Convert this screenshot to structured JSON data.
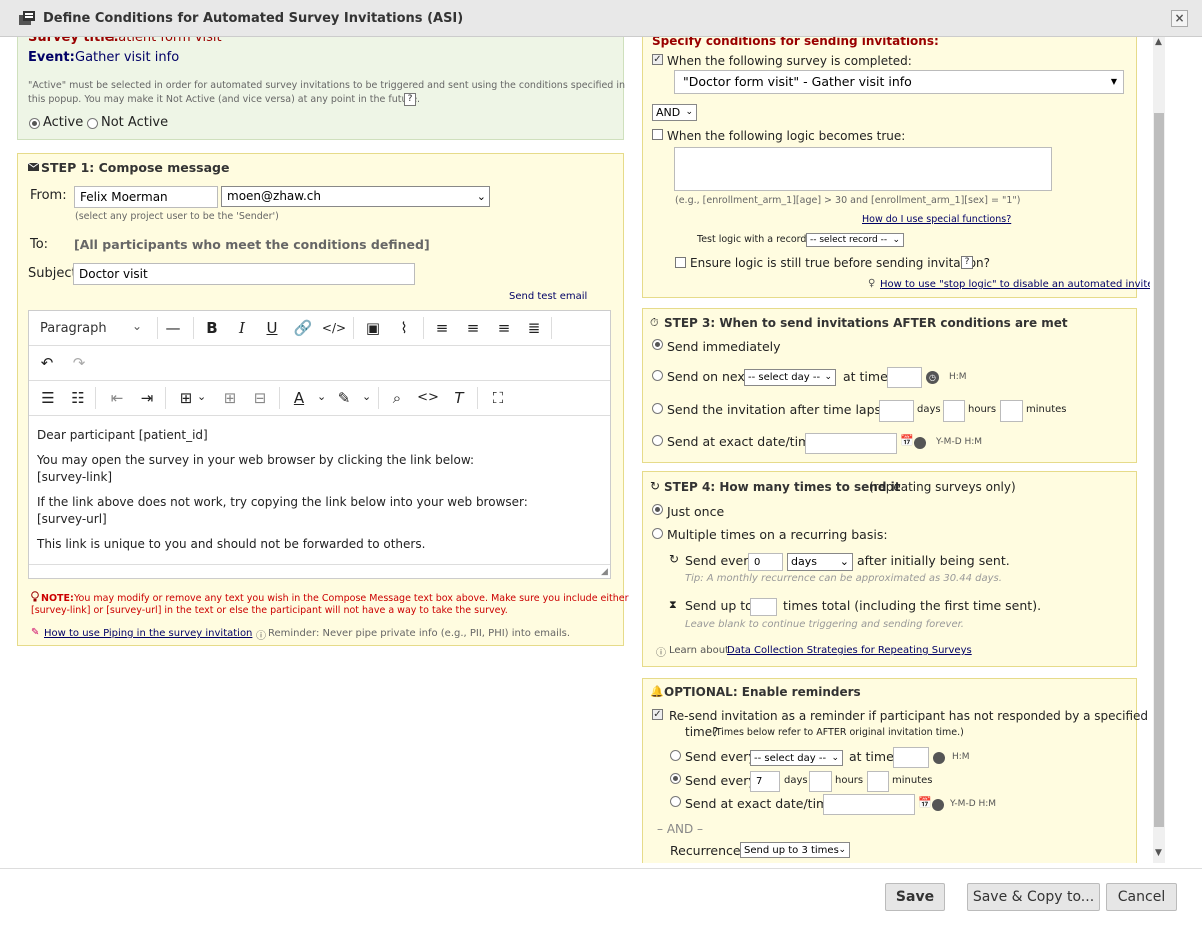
{
  "dialog": {
    "title": "Define Conditions for Automated Survey Invitations (ASI)",
    "close_label": "×"
  },
  "info": {
    "survey_label": "Survey title:",
    "survey_value": "Patient form visit",
    "event_label": "Event:",
    "event_value": "Gather visit info",
    "note_line1": "\"Active\" must be selected in order for automated survey invitations to be triggered and sent using the conditions specified in",
    "note_line2": "this popup. You may make it Not Active (and vice versa) at any point in the future.",
    "help": "?",
    "active": "Active",
    "not_active": "Not Active"
  },
  "step1": {
    "title": "STEP 1: Compose message",
    "from_label": "From:",
    "from_name": "Felix Moerman",
    "from_email": "moen@zhaw.ch",
    "from_hint": "(select any project user to be the 'Sender')",
    "to_label": "To:",
    "to_value": "[All participants who meet the conditions defined]",
    "subject_label": "Subject:",
    "subject_value": "Doctor visit",
    "send_test": "Send test email",
    "paragraph": "Paragraph",
    "body": {
      "l1": "Dear participant [patient_id]",
      "l2": "You may open the survey in your web browser by clicking the link below:",
      "l3": "[survey-link]",
      "l4": "If the link above does not work, try copying the link below into your web browser:",
      "l5": "[survey-url]",
      "l6": "This link is unique to you and should not be forwarded to others."
    },
    "note_label": "NOTE:",
    "note_line1": "You may modify or remove any text you wish in the Compose Message text box above. Make sure you include either",
    "note_line2": "[survey-link] or [survey-url] in the text or else the participant will not have a way to take the survey.",
    "piping_link": "How to use Piping in the survey invitation",
    "reminder": "Reminder: Never pipe private info (e.g., PII, PHI) into emails."
  },
  "step2": {
    "title": "Specify conditions for sending invitations:",
    "survey_completed": "When the following survey is completed:",
    "survey_select": "\"Doctor form visit\" - Gather visit info",
    "and_select": "AND",
    "logic_true": "When the following logic becomes true:",
    "logic_example": "(e.g., [enrollment_arm_1][age] > 30 and [enrollment_arm_1][sex] = \"1\")",
    "special_functions": "How do I use special functions?",
    "test_logic": "Test logic with a record:",
    "select_record": "-- select record --",
    "ensure_logic": "Ensure logic is still true before sending invitation?",
    "help": "?",
    "stop_logic": "How to use \"stop logic\" to disable an automated invite"
  },
  "step3": {
    "title": "STEP 3: When to send invitations AFTER conditions are met",
    "immediately": "Send immediately",
    "on_next": "Send on next",
    "select_day": "-- select day --",
    "at_time": "at time",
    "hm": "H:M",
    "time_lapse": "Send the invitation after time lapse of",
    "days": "days",
    "hours": "hours",
    "minutes": "minutes",
    "exact": "Send at exact date/time:",
    "ymdhm": "Y-M-D H:M"
  },
  "step4": {
    "title": "STEP 4: How many times to send it",
    "title_suffix": "(repeating surveys only)",
    "just_once": "Just once",
    "multiple": "Multiple times on a recurring basis:",
    "send_every": "Send every",
    "every_value": "0",
    "days_select": "days",
    "after": "after initially being sent.",
    "tip1": "Tip: A monthly recurrence can be approximated as 30.44 days.",
    "send_up_to": "Send up to",
    "times_total": "times total (including the first time sent).",
    "tip2": "Leave blank to continue triggering and sending forever.",
    "learn": "Learn about",
    "learn_link": "Data Collection Strategies for Repeating Surveys"
  },
  "reminders": {
    "title": "OPTIONAL: Enable reminders",
    "resend_line1": "Re-send invitation as a reminder if participant has not responded by a specified",
    "resend_line2": "time?",
    "resend_note": "(Times below refer to AFTER original invitation time.)",
    "send_every": "Send every",
    "select_day": "-- select day --",
    "at_time": "at time",
    "hm": "H:M",
    "days_value": "7",
    "days": "days",
    "hours": "hours",
    "minutes": "minutes",
    "exact": "Send at exact date/time:",
    "ymdhm": "Y-M-D H:M",
    "and": "– AND –",
    "recurrence_label": "Recurrence:",
    "recurrence_value": "Send up to 3 times"
  },
  "footer": {
    "save": "Save",
    "save_copy": "Save & Copy to...",
    "cancel": "Cancel"
  },
  "colors": {
    "panel_bg": "#fffce0",
    "panel_border": "#e6db8a",
    "green_bg": "#eef5e6",
    "label_red": "#990000"
  }
}
